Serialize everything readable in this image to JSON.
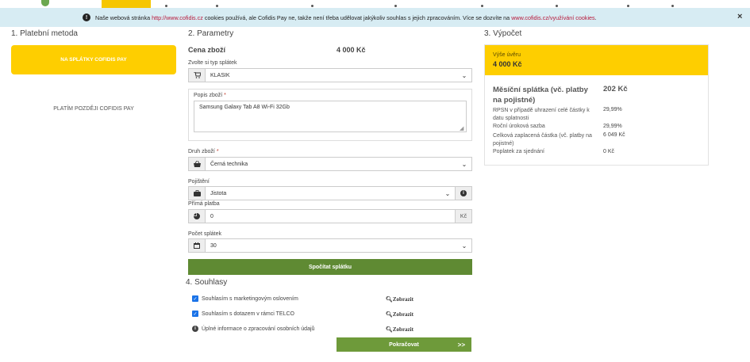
{
  "cookie": {
    "text_before": "Naše webová stránka",
    "link1": "http://www.cofidis.cz",
    "text_middle": "cookies používá, ale Cofidis Pay ne, takže není třeba udělovat jakýkoliv souhlas s jejich zpracováním. Více se dozvíte na",
    "link2": "www.cofidis.cz/využívání cookies",
    "text_end": ".",
    "close": "×"
  },
  "payment": {
    "title": "1. Platební metoda",
    "primary_button": "NA SPLÁTKY COFIDIS PAY",
    "secondary_option": "PLATÍM POZDĚJI COFIDIS PAY"
  },
  "params": {
    "title": "2. Parametry",
    "price_label": "Cena zboží",
    "price_value": "4 000 Kč",
    "type_label": "Zvolte si typ splátek",
    "type_value": "KLASIK",
    "desc_label": "Popis zboží",
    "desc_value": "Samsung Galaxy Tab A8 Wi-Fi 32Gb",
    "kind_label": "Druh zboží",
    "kind_value": "Černá technika",
    "insurance_label": "Pojištění",
    "insurance_value": "Jistota",
    "direct_label": "Přímá platba",
    "direct_value": "0",
    "direct_unit": "Kč",
    "count_label": "Počet splátek",
    "count_value": "30",
    "calc_button": "Spočítat splátku",
    "required_mark": "*"
  },
  "consents": {
    "title": "4. Souhlasy",
    "items": [
      {
        "text": "Souhlasím s marketingovým oslovením",
        "link": "Zobrazit"
      },
      {
        "text": "Souhlasím s dotazem v rámci TELCO",
        "link": "Zobrazit"
      },
      {
        "text": "Úplné informace o zpracování osobních údajů",
        "link": "Zobrazit"
      }
    ],
    "continue_button": "Pokračovat",
    "continue_arrows": ">>"
  },
  "summary": {
    "title": "3. Výpočet",
    "loan_label": "Výše úvěru",
    "loan_value": "4 000 Kč",
    "monthly_label": "Měsíční splátka (vč. platby na pojistné)",
    "monthly_value": "202 Kč",
    "rows": [
      {
        "label": "RPSN v případě uhrazení celé částky k datu splatnosti",
        "value": "29,99%"
      },
      {
        "label": "Roční úroková sazba",
        "value": "29,99%"
      },
      {
        "label": "Celková zaplacená částka (vč. platby na pojistné)",
        "value": "6 049 Kč"
      },
      {
        "label": "Poplatek za sjednání",
        "value": "0 Kč"
      }
    ]
  },
  "colors": {
    "accent_yellow": "#fece00",
    "accent_green": "#5f8a33",
    "cookie_bar": "#d7ecf3",
    "link_red": "#b8183a"
  },
  "icons": {
    "info": "info-icon",
    "cart": "cart-icon",
    "basket": "basket-icon",
    "briefcase": "briefcase-icon",
    "pie": "pie-chart-icon",
    "calendar": "calendar-icon",
    "zoom": "zoom-icon"
  }
}
